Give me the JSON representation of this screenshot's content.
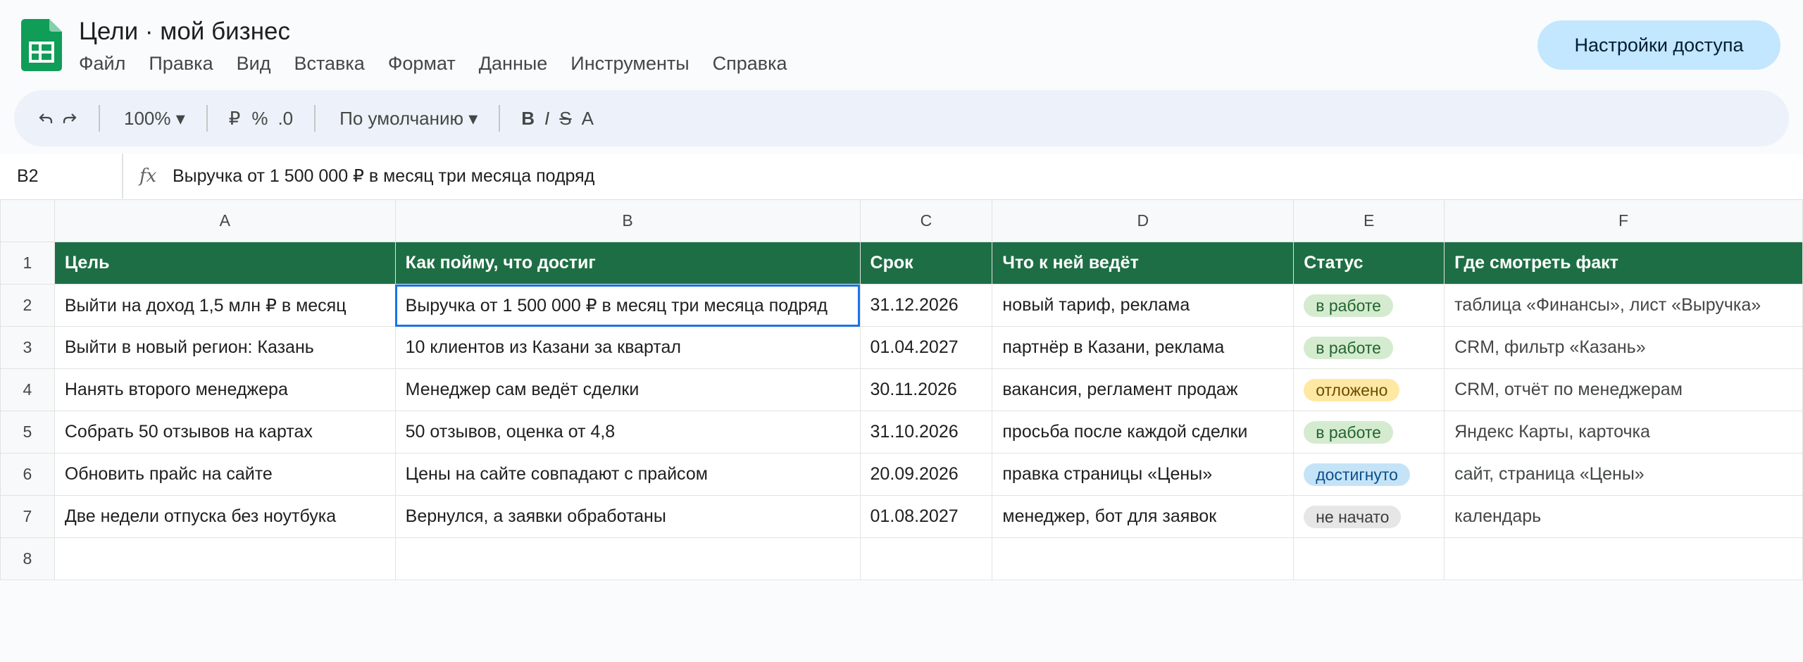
{
  "document": {
    "title": "Цели · мой бизнес"
  },
  "menu": [
    "Файл",
    "Правка",
    "Вид",
    "Вставка",
    "Формат",
    "Данные",
    "Инструменты",
    "Справка"
  ],
  "share_button": "Настройки доступа",
  "toolbar": {
    "undo_icon": "undo-icon",
    "redo_icon": "redo-icon",
    "zoom": "100% ▾",
    "currency": "₽",
    "percent": "%",
    "decimal": ".0",
    "font": "По умолчанию ▾",
    "bold": "B",
    "italic": "I",
    "strike": "S",
    "text_color": "A"
  },
  "formula_bar": {
    "cell_ref": "B2",
    "fx": "fx",
    "value": "Выручка от 1 500 000 ₽ в месяц три месяца подряд"
  },
  "grid": {
    "columns": [
      "A",
      "B",
      "C",
      "D",
      "E",
      "F"
    ],
    "row_numbers": [
      "1",
      "2",
      "3",
      "4",
      "5",
      "6",
      "7",
      "8"
    ],
    "header": [
      "Цель",
      "Как пойму, что достиг",
      "Срок",
      "Что к ней ведёт",
      "Статус",
      "Где смотреть факт"
    ],
    "rows": [
      {
        "goal": "Выйти на доход 1,5 млн ₽ в месяц",
        "criterion": "Выручка от 1 500 000 ₽ в месяц три месяца подряд",
        "deadline": "31.12.2026",
        "drivers": "новый тариф, реклама",
        "status": "в работе",
        "status_color": "#d4ebcf",
        "source": "таблица «Финансы», лист «Выручка»"
      },
      {
        "goal": "Выйти в новый регион: Казань",
        "criterion": "10 клиентов из Казани за квартал",
        "deadline": "01.04.2027",
        "drivers": "партнёр в Казани, реклама",
        "status": "в работе",
        "status_color": "#d4ebcf",
        "source": "CRM, фильтр «Казань»"
      },
      {
        "goal": "Нанять второго менеджера",
        "criterion": "Менеджер сам ведёт сделки",
        "deadline": "30.11.2026",
        "drivers": "вакансия, регламент продаж",
        "status": "отложено",
        "status_color": "#ffe8a3",
        "source": "CRM, отчёт по менеджерам"
      },
      {
        "goal": "Собрать 50 отзывов на картах",
        "criterion": "50 отзывов, оценка от 4,8",
        "deadline": "31.10.2026",
        "drivers": "просьба после каждой сделки",
        "status": "в работе",
        "status_color": "#d4ebcf",
        "source": "Яндекс Карты, карточка"
      },
      {
        "goal": "Обновить прайс на сайте",
        "criterion": "Цены на сайте совпадают с прайсом",
        "deadline": "20.09.2026",
        "drivers": "правка страницы «Цены»",
        "status": "достигнуто",
        "status_color": "#c5e3f7",
        "source": "сайт, страница «Цены»"
      },
      {
        "goal": "Две недели отпуска без ноутбука",
        "criterion": "Вернулся, а заявки обработаны",
        "deadline": "01.08.2027",
        "drivers": "менеджер, бот для заявок",
        "status": "не начато",
        "status_color": "#e6e6e6",
        "source": "календарь"
      }
    ],
    "header_color": "#1e6e45",
    "selected_cell": "B2",
    "selection_color": "#1a73e8"
  }
}
